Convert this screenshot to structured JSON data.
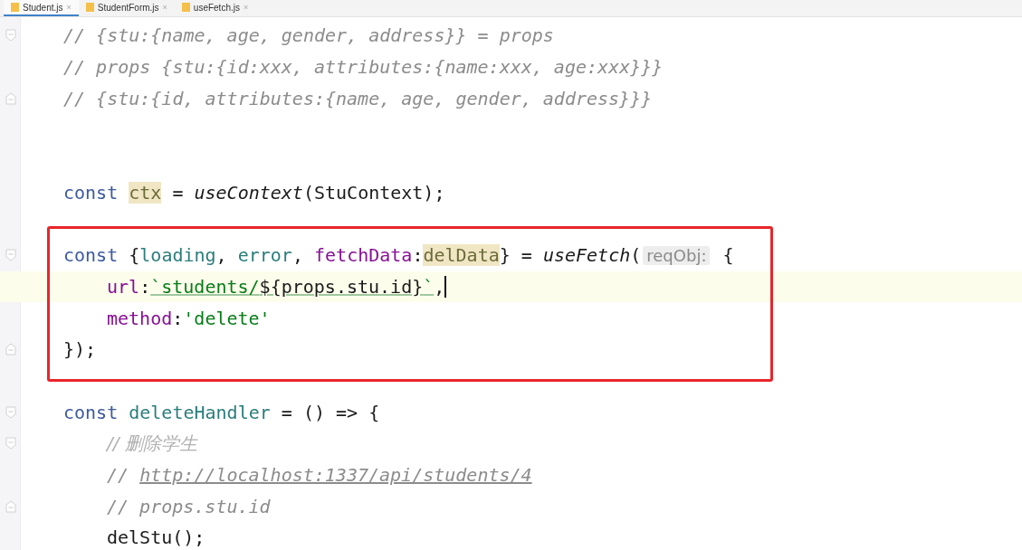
{
  "tabs": [
    {
      "label": "Student.js",
      "close": "×",
      "selected": true
    },
    {
      "label": "StudentForm.js",
      "close": "×",
      "selected": false
    },
    {
      "label": "useFetch.js",
      "close": "×",
      "selected": false
    }
  ],
  "blocks": [
    {
      "boxed": false,
      "lines": [
        {
          "kind": "code",
          "fold_start": true,
          "tokens": [
            {
              "kind": "comment",
              "text": "// {stu:{name, age, gender, address}} = props"
            }
          ]
        },
        {
          "kind": "code",
          "tokens": [
            {
              "kind": "comment",
              "text": "// props {stu:{id:xxx, attributes:{name:xxx, age:xxx}}}"
            }
          ]
        },
        {
          "kind": "code",
          "fold_end": true,
          "tokens": [
            {
              "kind": "comment",
              "text": "// {stu:{id, attributes:{name, age, gender, address}}}"
            }
          ]
        },
        {
          "kind": "blank"
        },
        {
          "kind": "blank"
        },
        {
          "kind": "code",
          "tokens": [
            {
              "kind": "kw",
              "text": "const "
            },
            {
              "kind": "hl",
              "text": "ctx"
            },
            {
              "kind": "plain",
              "text": " = "
            },
            {
              "kind": "fn",
              "text": "useContext"
            },
            {
              "kind": "plain",
              "text": "(StuContext);"
            }
          ]
        },
        {
          "kind": "blank"
        }
      ]
    },
    {
      "boxed": true,
      "lines": [
        {
          "kind": "code",
          "fold_start": true,
          "tokens": [
            {
              "kind": "kw",
              "text": "const"
            },
            {
              "kind": "plain",
              "text": " {"
            },
            {
              "kind": "var",
              "text": "loading"
            },
            {
              "kind": "plain",
              "text": ", "
            },
            {
              "kind": "var",
              "text": "error"
            },
            {
              "kind": "plain",
              "text": ", "
            },
            {
              "kind": "field",
              "text": "fetchData"
            },
            {
              "kind": "plain",
              "text": ":"
            },
            {
              "kind": "hl",
              "text": "delData"
            },
            {
              "kind": "plain",
              "text": "} = "
            },
            {
              "kind": "fn",
              "text": "useFetch"
            },
            {
              "kind": "plain",
              "text": "("
            },
            {
              "kind": "hint",
              "text": "reqObj:"
            },
            {
              "kind": "plain",
              "text": " {"
            }
          ]
        },
        {
          "kind": "code",
          "indented": true,
          "current": true,
          "tokens": [
            {
              "kind": "field",
              "text": "url"
            },
            {
              "kind": "plain",
              "text": ":"
            },
            {
              "kind": "str-u",
              "text": "`students/"
            },
            {
              "kind": "plain-u",
              "text": "${props.stu.id}"
            },
            {
              "kind": "str-u",
              "text": "`"
            },
            {
              "kind": "plain",
              "text": ","
            }
          ]
        },
        {
          "kind": "code",
          "indented": true,
          "tokens": [
            {
              "kind": "field",
              "text": "method"
            },
            {
              "kind": "plain",
              "text": ":"
            },
            {
              "kind": "str",
              "text": "'delete'"
            }
          ]
        },
        {
          "kind": "code",
          "fold_end": true,
          "tokens": [
            {
              "kind": "plain",
              "text": "});"
            }
          ]
        }
      ]
    },
    {
      "boxed": false,
      "lines": [
        {
          "kind": "blank"
        },
        {
          "kind": "code",
          "fold_start": true,
          "tokens": [
            {
              "kind": "kw",
              "text": "const "
            },
            {
              "kind": "var",
              "text": "deleteHandler"
            },
            {
              "kind": "plain",
              "text": " = () => {"
            }
          ]
        },
        {
          "kind": "code",
          "indented": true,
          "fold_start": true,
          "tokens": [
            {
              "kind": "comment-cjk",
              "text": "// 删除学生"
            }
          ]
        },
        {
          "kind": "code",
          "indented": true,
          "tokens": [
            {
              "kind": "comment",
              "text": "// "
            },
            {
              "kind": "link",
              "text": "http://localhost:1337/api/students/4"
            }
          ]
        },
        {
          "kind": "code",
          "indented": true,
          "fold_end": true,
          "tokens": [
            {
              "kind": "comment",
              "text": "// props.stu.id"
            }
          ]
        },
        {
          "kind": "code",
          "indented": true,
          "tokens": [
            {
              "kind": "plain",
              "text": "delStu();"
            }
          ]
        }
      ]
    }
  ]
}
